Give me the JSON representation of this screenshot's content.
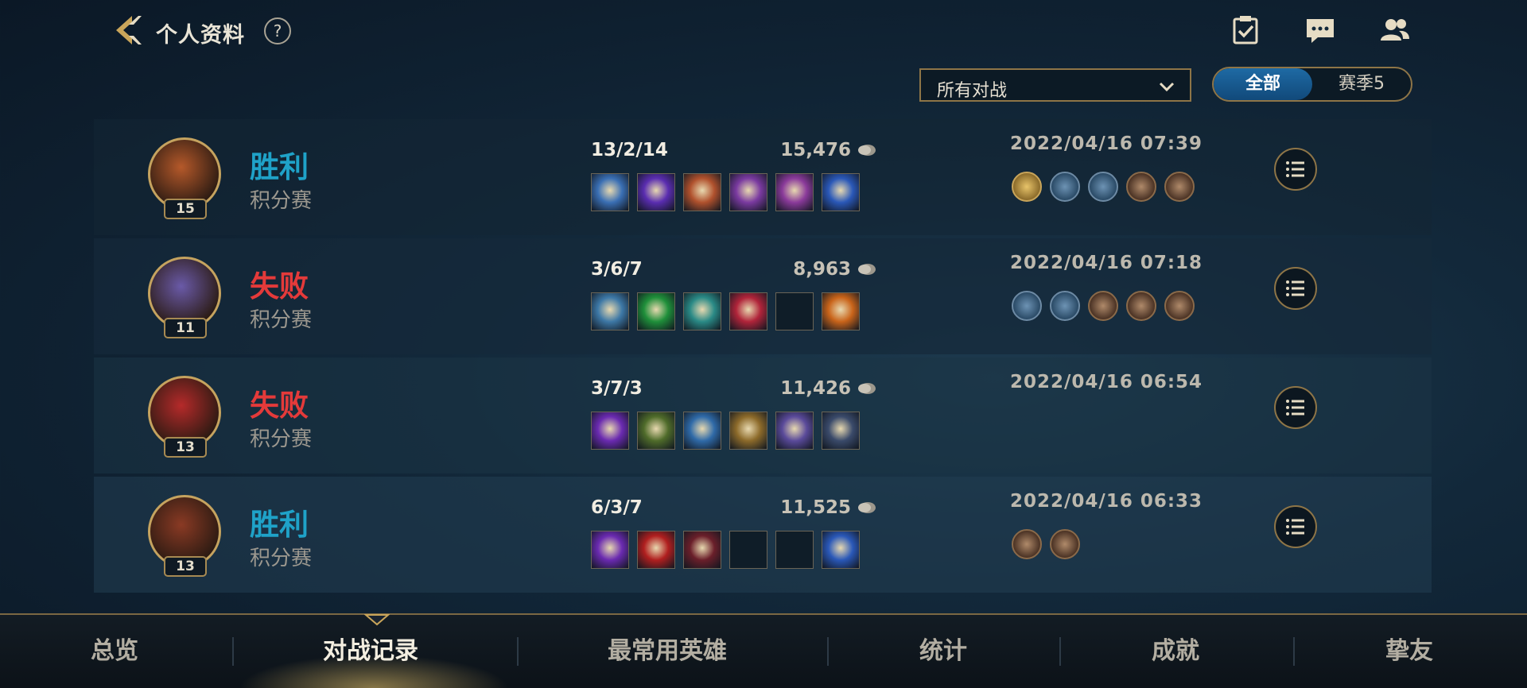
{
  "header": {
    "title": "个人资料",
    "help_glyph": "?"
  },
  "filters": {
    "mode_select_value": "所有对战",
    "season_tabs": [
      "全部",
      "赛季5"
    ],
    "active_tab": "全部"
  },
  "matches": [
    {
      "level": "15",
      "result": "胜利",
      "result_type": "win",
      "mode": "积分赛",
      "kda": "13/2/14",
      "gold": "15,476",
      "date": "2022/04/16 07:39",
      "items": [
        "#3a6fb4",
        "#5a2db0",
        "#b0512d",
        "#7a3aa0",
        "#8a3a9a",
        "#2a58b8"
      ],
      "badges": [
        "s-badge-icon",
        "three-badge-icon",
        "slash-badge-icon",
        "crown-badge-icon",
        "tower-badge-icon"
      ]
    },
    {
      "level": "11",
      "result": "失败",
      "result_type": "loss",
      "mode": "积分赛",
      "kda": "3/6/7",
      "gold": "8,963",
      "date": "2022/04/16 07:18",
      "items": [
        "#3d78a6",
        "#1f8f3a",
        "#2a8a86",
        "#b0243a",
        "empty",
        "#c9641a"
      ],
      "badges": [
        "shield-badge-icon",
        "heart-badge-icon",
        "tree-badge-icon",
        "card-badge-icon",
        "drop-badge-icon"
      ]
    },
    {
      "level": "13",
      "result": "失败",
      "result_type": "loss",
      "mode": "积分赛",
      "kda": "3/7/3",
      "gold": "11,426",
      "date": "2022/04/16 06:54",
      "items": [
        "#6a2ab0",
        "#4f6b2a",
        "#2f6aa8",
        "#8c6a2a",
        "#5a4a9a",
        "#3a4a6a"
      ],
      "badges": []
    },
    {
      "level": "13",
      "result": "胜利",
      "result_type": "win",
      "mode": "积分赛",
      "kda": "6/3/7",
      "gold": "11,525",
      "date": "2022/04/16 06:33",
      "items": [
        "#6a2ab0",
        "#b01f1f",
        "#6a1f2a",
        "empty",
        "empty",
        "#2a58b8"
      ],
      "badges": [
        "crown-badge-icon",
        "tree-badge-icon"
      ]
    }
  ],
  "avatars": [
    "#b5592a",
    "#6a5aa8",
    "#b52a2a",
    "#8a3a24"
  ],
  "nav": {
    "tabs": [
      "总览",
      "对战记录",
      "最常用英雄",
      "统计",
      "成就",
      "挚友"
    ],
    "active": "对战记录"
  },
  "colors": {
    "win": "#1fa2c8",
    "loss": "#e43a3a",
    "gold_border": "#c5a35f",
    "accent_blue": "#1e6aa4"
  },
  "icons": {
    "top_right": [
      "checklist-icon",
      "chat-icon",
      "friends-icon"
    ]
  }
}
